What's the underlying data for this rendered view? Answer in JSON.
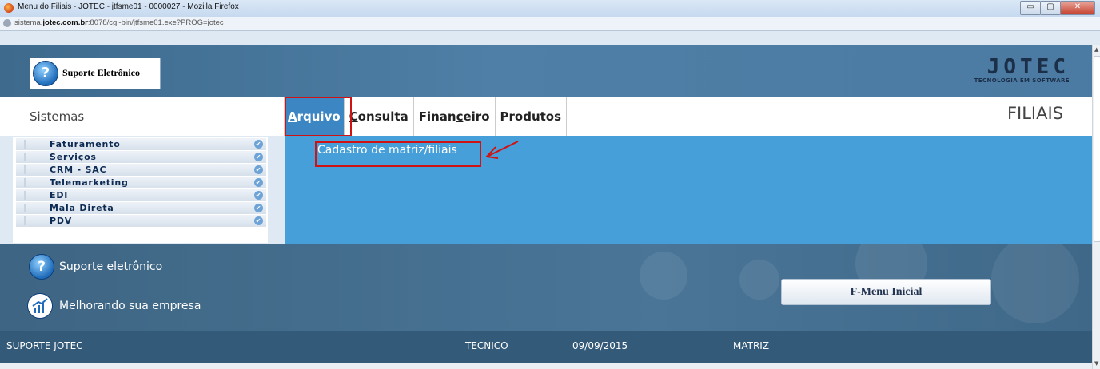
{
  "window": {
    "title": "Menu do Filiais - JOTEC - jtfsme01 - 0000027 - Mozilla Firefox",
    "url_prefix": "sistema.",
    "url_domain": "jotec.com.br",
    "url_rest": ":8078/cgi-bin/jtfsme01.exe?PROG=jotec",
    "min_label": "▭",
    "max_label": "▢",
    "close_label": "✕"
  },
  "header": {
    "logo_text": "Suporte Eletrônico",
    "logo_q": "?",
    "brand_big": "JOTEC",
    "brand_small": "TECNOLOGIA EM SOFTWARE"
  },
  "menu": {
    "sistemas_label": "Sistemas",
    "page_title": "FILIAIS",
    "items": [
      {
        "pre": "",
        "accel": "A",
        "post": "rquivo"
      },
      {
        "pre": "",
        "accel": "C",
        "post": "onsulta"
      },
      {
        "pre": "Finan",
        "accel": "c",
        "post": "eiro"
      },
      {
        "pre": "Produtos",
        "accel": "",
        "post": ""
      }
    ]
  },
  "sidebar": {
    "items": [
      "Faturamento",
      "Serviços",
      "CRM - SAC",
      "Telemarketing",
      "EDI",
      "Mala Direta",
      "PDV"
    ]
  },
  "submenu": {
    "link": "Cadastro de matriz/filiais"
  },
  "footer": {
    "line1": "Suporte eletrônico",
    "line2": "Melhorando sua empresa",
    "button": "F-Menu Inicial"
  },
  "status": {
    "company": "SUPORTE JOTEC",
    "user": "TECNICO",
    "date": "09/09/2015",
    "branch": "MATRIZ"
  },
  "colors": {
    "accent": "#469fd8",
    "highlight": "#d11212",
    "status_bg": "#335a78"
  }
}
